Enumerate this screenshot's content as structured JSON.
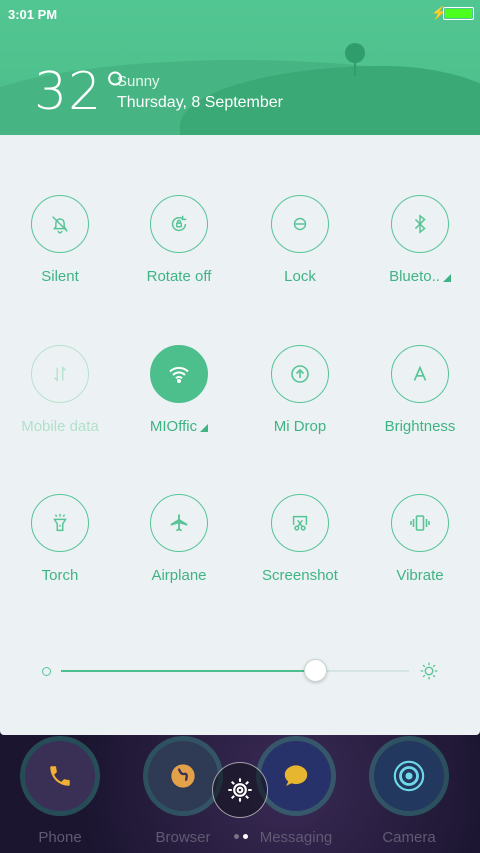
{
  "status": {
    "time": "3:01 PM"
  },
  "weather": {
    "temperature": "32°",
    "condition": "Sunny",
    "date": "Thursday, 8 September"
  },
  "toggles": [
    {
      "label": "Silent",
      "icon": "bell-off-icon",
      "state": "off"
    },
    {
      "label": "Rotate off",
      "icon": "rotate-lock-icon",
      "state": "off"
    },
    {
      "label": "Lock",
      "icon": "lock-icon",
      "state": "off"
    },
    {
      "label": "Blueto..",
      "icon": "bluetooth-icon",
      "state": "off",
      "has_submenu": true
    },
    {
      "label": "Mobile data",
      "icon": "mobile-data-icon",
      "state": "disabled"
    },
    {
      "label": "MIOffic",
      "icon": "wifi-icon",
      "state": "on",
      "has_submenu": true
    },
    {
      "label": "Mi Drop",
      "icon": "upload-icon",
      "state": "off"
    },
    {
      "label": "Brightness",
      "icon": "auto-brightness-icon",
      "state": "off"
    },
    {
      "label": "Torch",
      "icon": "torch-icon",
      "state": "off"
    },
    {
      "label": "Airplane",
      "icon": "airplane-icon",
      "state": "off"
    },
    {
      "label": "Screenshot",
      "icon": "scissors-icon",
      "state": "off"
    },
    {
      "label": "Vibrate",
      "icon": "vibrate-icon",
      "state": "off"
    }
  ],
  "brightness": {
    "level": 0.73
  },
  "dock": {
    "apps": [
      {
        "label": "Phone",
        "icon": "phone-icon"
      },
      {
        "label": "Browser",
        "icon": "globe-icon"
      },
      {
        "label": "Messaging",
        "icon": "chat-icon"
      },
      {
        "label": "Camera",
        "icon": "camera-icon"
      }
    ],
    "page_indicator": {
      "pages": 2,
      "current": 2
    }
  },
  "colors": {
    "accent": "#4dbf8d",
    "header": "#52c692",
    "panel": "#ecf2f3"
  }
}
